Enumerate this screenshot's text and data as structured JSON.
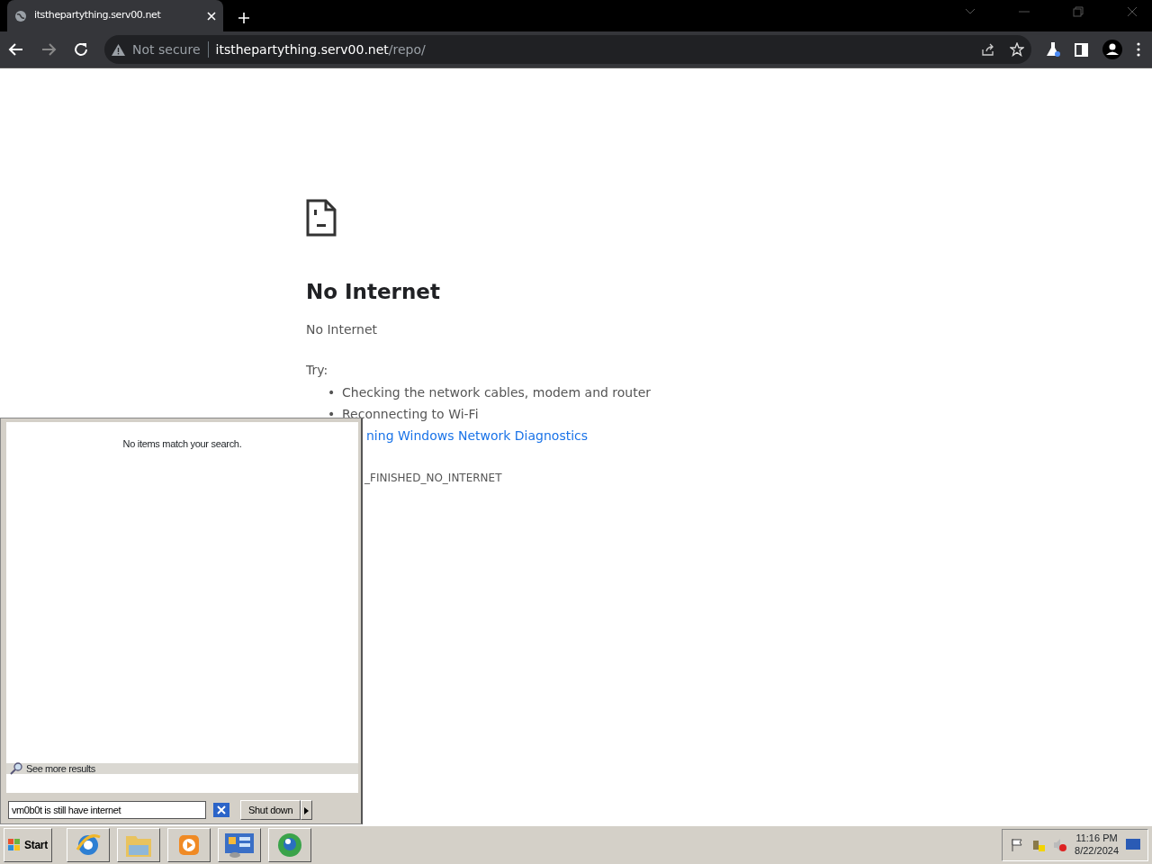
{
  "browser": {
    "tab": {
      "title": "itsthepartything.serv00.net"
    },
    "address": {
      "security": "Not secure",
      "host": "itsthepartything.serv00.net",
      "path": "/repo/"
    }
  },
  "error_page": {
    "heading": "No Internet",
    "message": "No Internet",
    "try_label": "Try:",
    "suggestions": [
      {
        "marker": "•",
        "text": "Checking the network cables, modem and router",
        "kind": "text"
      },
      {
        "marker": "•",
        "text": "Reconnecting to Wi-Fi",
        "kind": "text"
      },
      {
        "text": "ning Windows Network Diagnostics",
        "kind": "link"
      }
    ],
    "error_code": "_FINISHED_NO_INTERNET"
  },
  "start_menu": {
    "message": "No items match your search.",
    "more_results": "See more results",
    "search": {
      "value": "vm0b0t is still have internet"
    },
    "shutdown": "Shut down"
  },
  "taskbar": {
    "start": "Start",
    "clock": {
      "time": "11:16 PM",
      "date": "8/22/2024"
    }
  }
}
